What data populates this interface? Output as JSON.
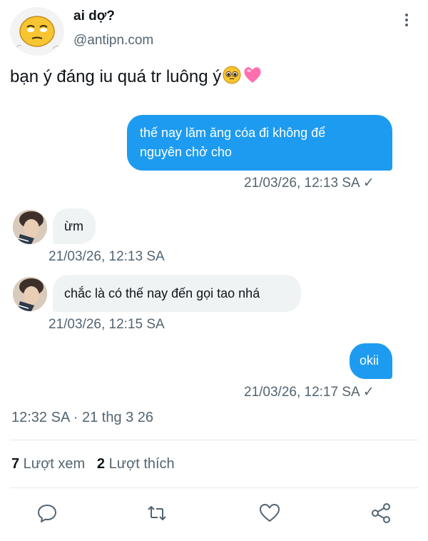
{
  "author": {
    "name": "ai dợ?",
    "handle": "@antipn.com",
    "avatar_icon": "pensive-face-emoji"
  },
  "menu_icon": "more-vertical-icon",
  "tweet": {
    "text": "bạn ý đáng iu quá tr luông ý",
    "emojis": [
      "pleading-face-emoji",
      "pink-heart-emoji"
    ]
  },
  "messages": [
    {
      "direction": "out",
      "lines": [
        "thế nay lăm ăng cóa đi không để",
        "nguyên chở cho"
      ],
      "timestamp": "21/03/26, 12:13 SA ✓"
    },
    {
      "direction": "in",
      "lines": [
        "ừm"
      ],
      "timestamp": "21/03/26, 12:13 SA"
    },
    {
      "direction": "in",
      "lines": [
        "chắc là có thế nay đến gọi tao nhá"
      ],
      "timestamp": "21/03/26, 12:15 SA"
    },
    {
      "direction": "out",
      "lines": [
        "okii"
      ],
      "timestamp": "21/03/26, 12:17 SA ✓"
    }
  ],
  "meta": "12:32 SA · 21 thg 3 26",
  "stats": {
    "views_count": "7",
    "views_label": " Lượt xem",
    "likes_count": "2",
    "likes_label": " Lượt thích"
  },
  "actions": [
    "reply-icon",
    "retweet-icon",
    "like-icon",
    "share-icon"
  ],
  "colors": {
    "accent": "#1d9bf0",
    "incoming_bubble": "#eff3f4",
    "secondary_text": "#536471"
  }
}
